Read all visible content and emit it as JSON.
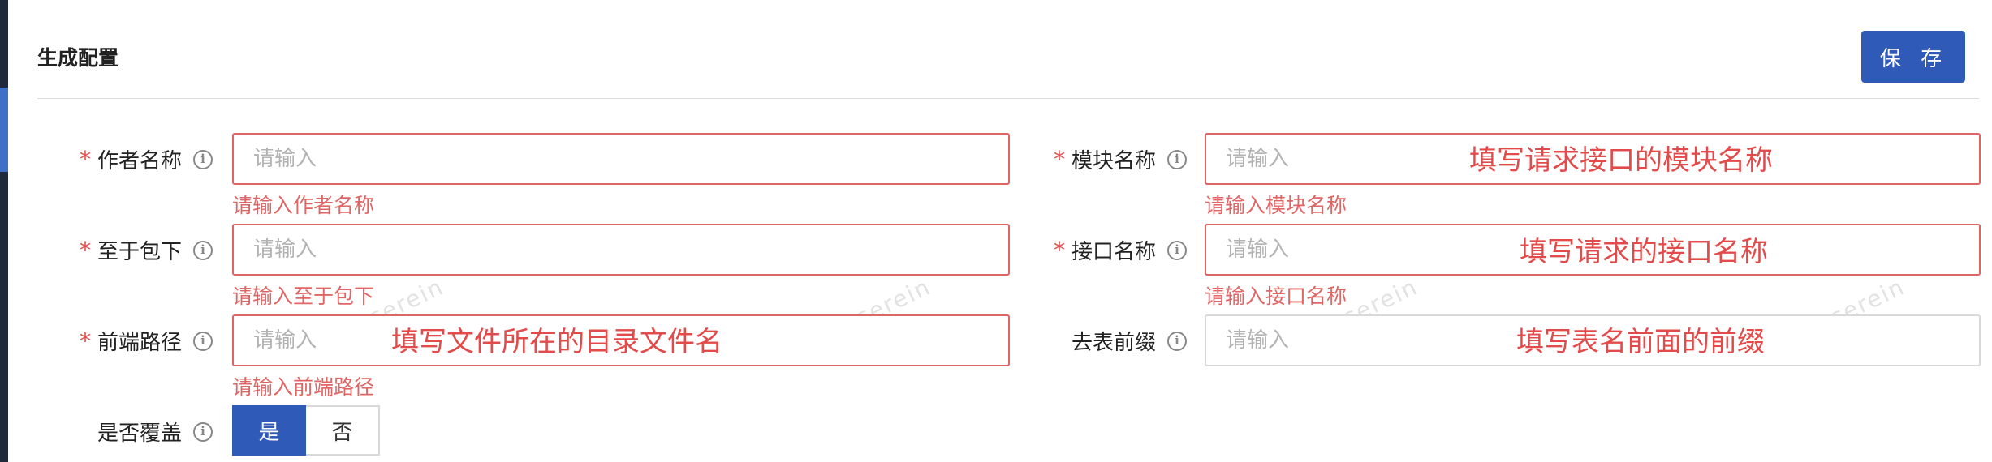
{
  "header": {
    "title": "生成配置",
    "save_label": "保 存"
  },
  "info_icon_glyph": "i",
  "required_mark": "*",
  "fields": {
    "author": {
      "label": "作者名称",
      "placeholder": "请输入",
      "error": "请输入作者名称"
    },
    "module": {
      "label": "模块名称",
      "placeholder": "请输入",
      "error": "请输入模块名称",
      "annotation": "填写请求接口的模块名称"
    },
    "package": {
      "label": "至于包下",
      "placeholder": "请输入",
      "error": "请输入至于包下"
    },
    "api": {
      "label": "接口名称",
      "placeholder": "请输入",
      "error": "请输入接口名称",
      "annotation": "填写请求的接口名称"
    },
    "frontend_path": {
      "label": "前端路径",
      "placeholder": "请输入",
      "error": "请输入前端路径",
      "annotation": "填写文件所在的目录文件名"
    },
    "table_prefix": {
      "label": "去表前缀",
      "placeholder": "请输入",
      "annotation": "填写表名前面的前缀"
    },
    "overwrite": {
      "label": "是否覆盖",
      "options": [
        "是",
        "否"
      ],
      "selected": "是"
    }
  },
  "watermark": "serein",
  "colors": {
    "primary": "#2f5ab8",
    "error": "#e06666",
    "annotation": "#e34b4b"
  }
}
